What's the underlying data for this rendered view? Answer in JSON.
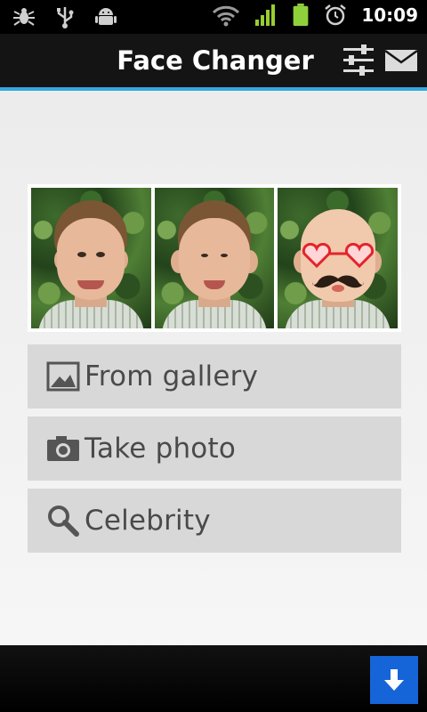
{
  "status_bar": {
    "time": "10:09",
    "left_icons": [
      "bug-icon",
      "usb-icon",
      "android-icon"
    ],
    "right_icons": [
      "wifi-icon",
      "signal-icon",
      "battery-icon",
      "alarm-icon"
    ],
    "signal_color": "#9acd32",
    "battery_color": "#8fd13b"
  },
  "action_bar": {
    "title": "Face Changer",
    "accent_color": "#36a9df",
    "actions": [
      {
        "icon": "settings-sliders-icon"
      },
      {
        "icon": "mail-icon"
      }
    ]
  },
  "preview_strip": {
    "photos": [
      {
        "variant": "original"
      },
      {
        "variant": "morphed"
      },
      {
        "variant": "bald-with-glasses-and-mustache"
      }
    ]
  },
  "menu": {
    "items": [
      {
        "label": "From gallery",
        "icon": "gallery-image-icon"
      },
      {
        "label": "Take photo",
        "icon": "camera-icon"
      },
      {
        "label": "Celebrity",
        "icon": "search-magnifier-icon"
      }
    ]
  },
  "bottom_bar": {
    "download_icon": "download-arrow-icon",
    "download_color": "#1565d8"
  }
}
